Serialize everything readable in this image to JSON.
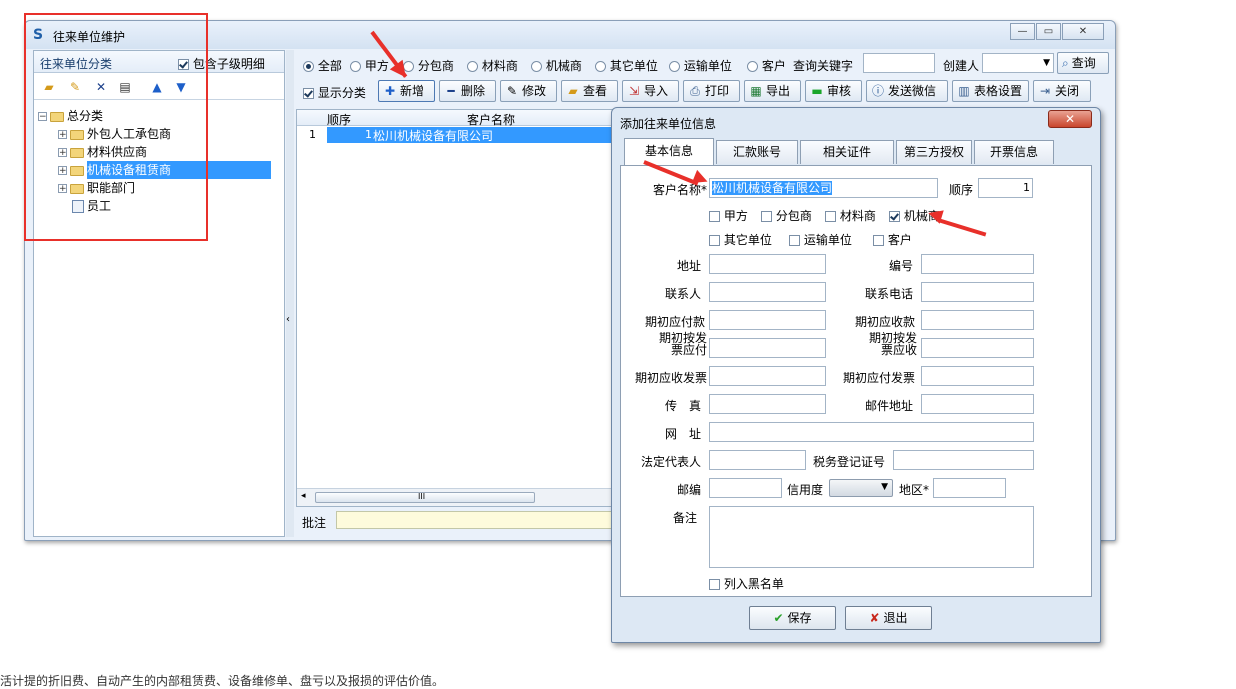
{
  "window": {
    "title": "往来单位维护"
  },
  "left_panel": {
    "header_label": "往来单位分类",
    "include_children_label": "包含子级明细",
    "tree": {
      "root": "总分类",
      "items": [
        "外包人工承包商",
        "材料供应商",
        "机械设备租赁商",
        "职能部门",
        "员工"
      ]
    }
  },
  "filters": {
    "radios": [
      "全部",
      "甲方",
      "分包商",
      "材料商",
      "机械商",
      "其它单位",
      "运输单位",
      "客户"
    ],
    "keyword_label": "查询关键字",
    "creator_label": "创建人",
    "query_button": "查询"
  },
  "toolbar": {
    "show_category": "显示分类",
    "buttons": [
      "新增",
      "删除",
      "修改",
      "查看",
      "导入",
      "打印",
      "导出",
      "审核",
      "发送微信",
      "表格设置",
      "关闭"
    ]
  },
  "grid": {
    "columns": [
      "顺序",
      "客户名称"
    ],
    "rows": [
      {
        "no": "1",
        "order": "1",
        "name": "松川机械设备有限公司"
      }
    ],
    "scroll_mark": "III",
    "note_label": "批注"
  },
  "dialog": {
    "title": "添加往来单位信息",
    "tabs": [
      "基本信息",
      "汇款账号",
      "相关证件",
      "第三方授权",
      "开票信息"
    ],
    "customer_name_label": "客户名称*",
    "customer_name_value": "松川机械设备有限公司",
    "order_label": "顺序",
    "order_value": "1",
    "types_row1": [
      {
        "label": "甲方",
        "checked": false
      },
      {
        "label": "分包商",
        "checked": false
      },
      {
        "label": "材料商",
        "checked": false
      },
      {
        "label": "机械商",
        "checked": true
      }
    ],
    "types_row2": [
      {
        "label": "其它单位",
        "checked": false
      },
      {
        "label": "运输单位",
        "checked": false
      },
      {
        "label": "客户",
        "checked": false
      }
    ],
    "fields": {
      "address": "地址",
      "code": "编号",
      "contact": "联系人",
      "phone": "联系电话",
      "init_payable": "期初应付款",
      "init_receivable": "期初应收款",
      "init_inv_payable": "期初按发票应付",
      "init_inv_receivable": "期初按发票应收",
      "init_recv_invoice": "期初应收发票",
      "init_pay_invoice": "期初应付发票",
      "fax": "传　真",
      "email": "邮件地址",
      "website": "网　址",
      "legal_rep": "法定代表人",
      "tax_no": "税务登记证号",
      "postcode": "邮编",
      "credit": "信用度",
      "region": "地区*",
      "remark": "备注"
    },
    "blacklist_label": "列入黑名单",
    "save_button": "保存",
    "exit_button": "退出"
  },
  "footer_text": "活计提的折旧费、自动产生的内部租赁费、设备维修单、盘亏以及报损的评估价值。",
  "colors": {
    "annotation_red": "#e8302a",
    "selection_blue": "#3399ff",
    "window_frame": "#8a9fb8"
  }
}
